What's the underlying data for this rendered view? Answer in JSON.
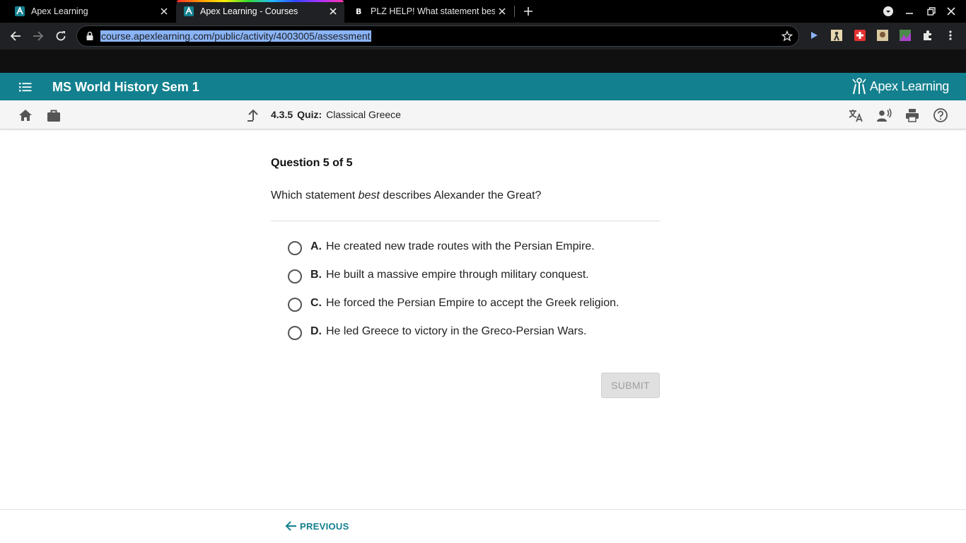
{
  "browser": {
    "tabs": [
      {
        "title": "Apex Learning",
        "active": false
      },
      {
        "title": "Apex Learning - Courses",
        "active": true
      },
      {
        "title": "PLZ HELP! What statement best",
        "active": false
      }
    ],
    "url": "course.apexlearning.com/public/activity/4003005/assessment"
  },
  "app": {
    "course_title": "MS World History Sem 1",
    "logo_text": "Apex Learning",
    "breadcrumb": {
      "number": "4.3.5",
      "type": "Quiz:",
      "title": "Classical Greece"
    }
  },
  "question": {
    "header": "Question 5 of 5",
    "text_before": "Which statement ",
    "text_emphasis": "best",
    "text_after": " describes Alexander the Great?",
    "answers": [
      {
        "letter": "A.",
        "text": "He created new trade routes with the Persian Empire."
      },
      {
        "letter": "B.",
        "text": "He built a massive empire through military conquest."
      },
      {
        "letter": "C.",
        "text": "He forced the Persian Empire to accept the Greek religion."
      },
      {
        "letter": "D.",
        "text": "He led Greece to victory in the Greco-Persian Wars."
      }
    ],
    "submit_label": "SUBMIT"
  },
  "footer": {
    "previous_label": "PREVIOUS"
  },
  "colors": {
    "brand_teal": "#13808f",
    "chrome_dark": "#202124"
  }
}
